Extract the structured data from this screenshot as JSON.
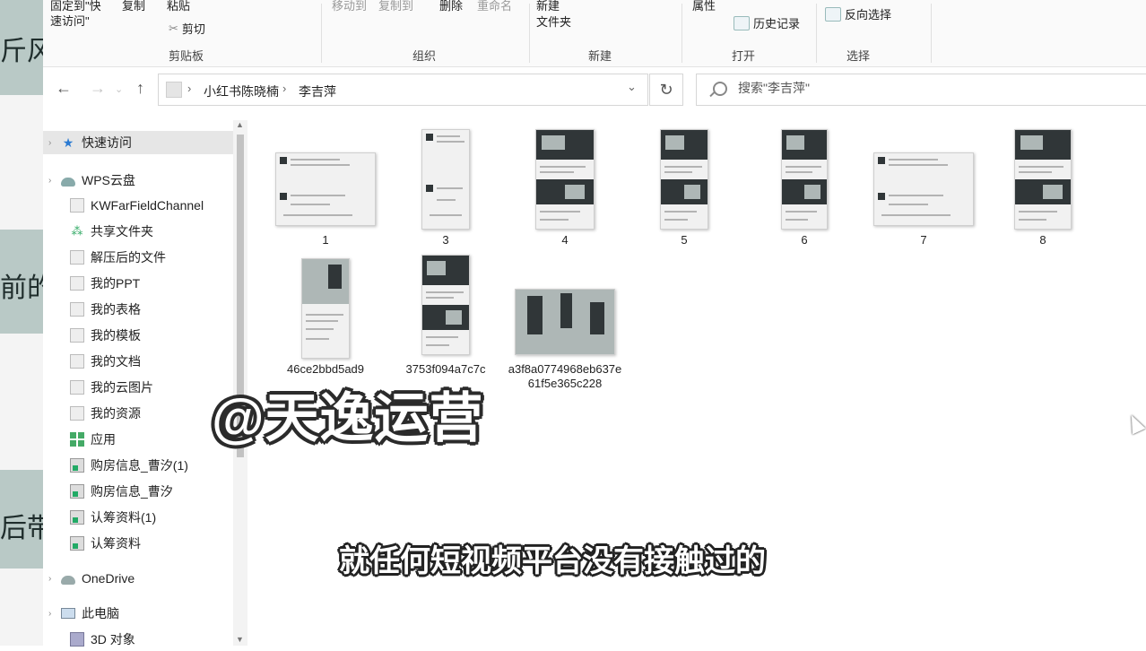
{
  "background": {
    "texts": [
      "斤风",
      "前的",
      "后带"
    ]
  },
  "ribbon": {
    "items": {
      "pin": "固定到\"快\n速访问\"",
      "copy": "复制",
      "paste": "粘贴",
      "cut": "剪切",
      "move_to": "移动到",
      "copy_to": "复制到",
      "delete": "删除",
      "rename": "重命名",
      "new_folder": "新建\n文件夹",
      "properties": "属性",
      "history": "历史记录",
      "invert_select": "反向选择"
    },
    "groups": {
      "clipboard": "剪贴板",
      "organize": "组织",
      "new": "新建",
      "open": "打开",
      "select": "选择"
    }
  },
  "address": {
    "crumbs": [
      "小红书陈晓楠",
      "李吉萍"
    ]
  },
  "search": {
    "placeholder": "搜索\"李吉萍\""
  },
  "nav_pane": {
    "items": [
      {
        "label": "快速访问",
        "icon": "star-icon"
      },
      {
        "label": "WPS云盘",
        "icon": "cloud-icon"
      },
      {
        "label": "KWFarFieldChannel",
        "icon": "document-icon"
      },
      {
        "label": "共享文件夹",
        "icon": "share-icon"
      },
      {
        "label": "解压后的文件",
        "icon": "document-icon"
      },
      {
        "label": "我的PPT",
        "icon": "document-icon"
      },
      {
        "label": "我的表格",
        "icon": "document-icon"
      },
      {
        "label": "我的模板",
        "icon": "document-icon"
      },
      {
        "label": "我的文档",
        "icon": "document-icon"
      },
      {
        "label": "我的云图片",
        "icon": "document-icon"
      },
      {
        "label": "我的资源",
        "icon": "document-icon"
      },
      {
        "label": "应用",
        "icon": "apps-icon"
      },
      {
        "label": "购房信息_曹汐(1)",
        "icon": "zip-icon"
      },
      {
        "label": "购房信息_曹汐",
        "icon": "zip-icon"
      },
      {
        "label": "认筹资料(1)",
        "icon": "zip-icon"
      },
      {
        "label": "认筹资料",
        "icon": "zip-icon"
      },
      {
        "label": "OneDrive",
        "icon": "onedrive-icon"
      },
      {
        "label": "此电脑",
        "icon": "computer-icon"
      },
      {
        "label": "3D 对象",
        "icon": "3d-objects-icon"
      }
    ]
  },
  "files": [
    {
      "name": "1"
    },
    {
      "name": "3"
    },
    {
      "name": "4"
    },
    {
      "name": "5"
    },
    {
      "name": "6"
    },
    {
      "name": "7"
    },
    {
      "name": "8"
    },
    {
      "name": "46ce2bbd5ad9"
    },
    {
      "name": "3753f094a7c7c"
    },
    {
      "name": "a3f8a0774968eb637e61f5e365c228"
    }
  ],
  "overlay": {
    "watermark": "@天逸运营",
    "subtitle": "就任何短视频平台没有接触过的"
  }
}
